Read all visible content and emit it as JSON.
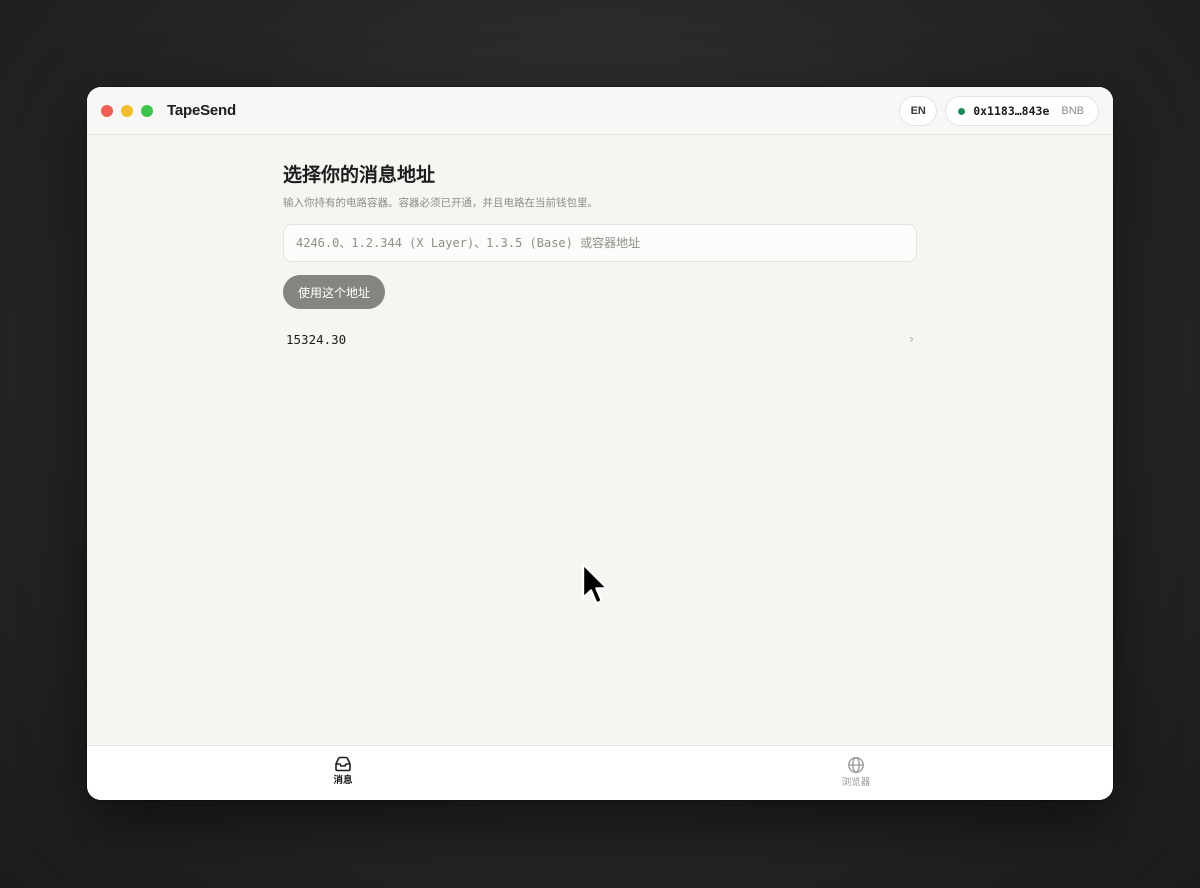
{
  "window": {
    "title": "TapeSend"
  },
  "header": {
    "language_label": "EN",
    "wallet_address": "0x1183…843e",
    "wallet_chain": "BNB",
    "status_color": "#1f8a5a"
  },
  "main": {
    "title": "选择你的消息地址",
    "subtitle": "输入你持有的电路容器。容器必须已开通，并且电路在当前钱包里。",
    "address_input": {
      "value": "",
      "placeholder": "4246.0、1.2.344 (X Layer)、1.3.5 (Base) 或容器地址"
    },
    "use_button_label": "使用这个地址",
    "saved_addresses": [
      {
        "label": "15324.30"
      }
    ]
  },
  "bottom_nav": {
    "tabs": [
      {
        "label": "消息",
        "icon": "inbox-icon",
        "active": true
      },
      {
        "label": "浏览器",
        "icon": "globe-icon",
        "active": false
      }
    ]
  },
  "colors": {
    "accent_button": "#858580",
    "window_bg": "#f5f5f2"
  }
}
